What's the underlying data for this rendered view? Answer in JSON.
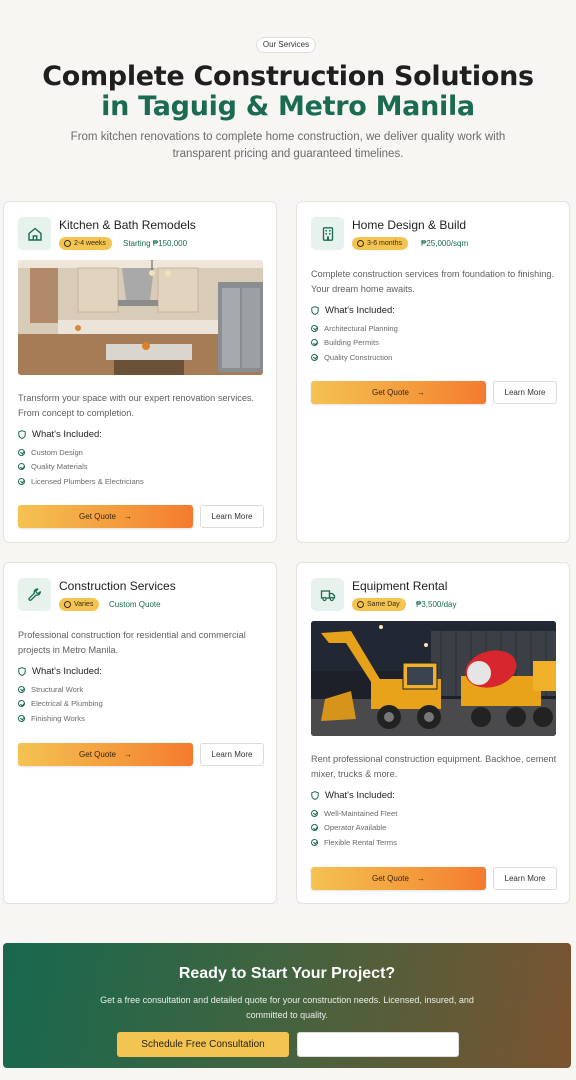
{
  "header": {
    "badge": "Our Services",
    "title_line1": "Complete Construction Solutions",
    "title_line2": "in Taguig & Metro Manila",
    "subtitle": "From kitchen renovations to complete home construction, we deliver quality work with transparent pricing and guaranteed timelines."
  },
  "cards": [
    {
      "title": "Kitchen & Bath Remodels",
      "icon": "home-icon",
      "duration": "2-4 weeks",
      "price": "Starting ₱150,000",
      "description": "Transform your space with our expert renovation services. From concept to completion.",
      "included_heading": "What's Included:",
      "included": [
        "Custom Design",
        "Quality Materials",
        "Licensed Plumbers & Electricians"
      ],
      "quote_label": "Get Quote",
      "more_label": "Learn More"
    },
    {
      "title": "Home Design & Build",
      "icon": "building-icon",
      "duration": "3-6 months",
      "price": "₱25,000/sqm",
      "description": "Complete construction services from foundation to finishing. Your dream home awaits.",
      "included_heading": "What's Included:",
      "included": [
        "Architectural Planning",
        "Building Permits",
        "Quality Construction"
      ],
      "quote_label": "Get Quote",
      "more_label": "Learn More"
    },
    {
      "title": "Construction Services",
      "icon": "wrench-icon",
      "duration": "Varies",
      "price": "Custom Quote",
      "description": "Professional construction for residential and commercial projects in Metro Manila.",
      "included_heading": "What's Included:",
      "included": [
        "Structural Work",
        "Electrical & Plumbing",
        "Finishing Works"
      ],
      "quote_label": "Get Quote",
      "more_label": "Learn More"
    },
    {
      "title": "Equipment Rental",
      "icon": "truck-icon",
      "duration": "Same Day",
      "price": "₱3,500/day",
      "description": "Rent professional construction equipment. Backhoe, cement mixer, trucks & more.",
      "included_heading": "What's Included:",
      "included": [
        "Well-Maintained Fleet",
        "Operator Available",
        "Flexible Rental Terms"
      ],
      "quote_label": "Get Quote",
      "more_label": "Learn More"
    }
  ],
  "cta": {
    "title": "Ready to Start Your Project?",
    "subtitle": "Get a free consultation and detailed quote for your construction needs. Licensed, insured, and committed to quality.",
    "primary_label": "Schedule Free Consultation",
    "secondary_label": ""
  },
  "colors": {
    "brand_green": "#1a6b52",
    "accent_yellow": "#f3c451",
    "accent_orange": "#f47a30"
  }
}
